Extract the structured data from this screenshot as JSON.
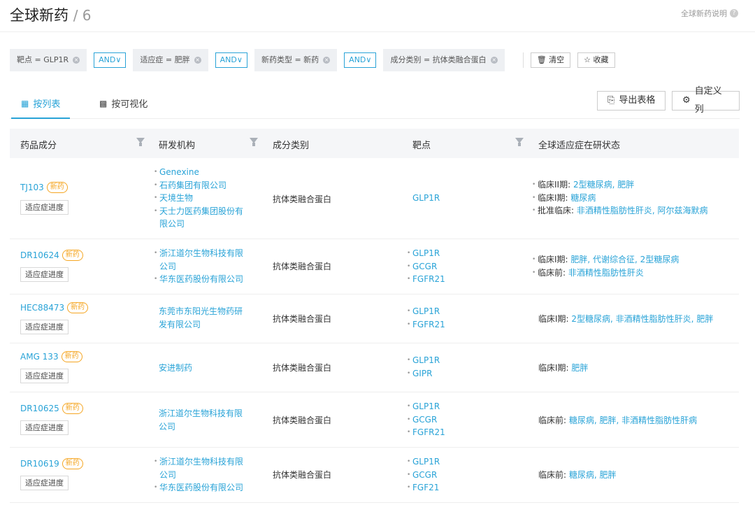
{
  "header": {
    "title": "全球新药",
    "count": "/ 6",
    "help": "全球新药说明"
  },
  "filters": [
    {
      "label": "靶点 = GLP1R"
    },
    {
      "label": "适应症 = 肥胖"
    },
    {
      "label": "新药类型 = 新药"
    },
    {
      "label": "成分类别 = 抗体类融合蛋白"
    }
  ],
  "and_label": "AND",
  "tools": {
    "clear": "清空",
    "favorite": "收藏"
  },
  "tabs": {
    "list": "按列表",
    "visual": "按可视化"
  },
  "buttons": {
    "export": "导出表格",
    "custom": "自定义列"
  },
  "columns": {
    "drug": "药品成分",
    "org": "研发机构",
    "category": "成分类别",
    "target": "靶点",
    "status": "全球适应症在研状态"
  },
  "badge": "新药",
  "progress_label": "适应症进度",
  "rows": [
    {
      "drug": "TJ103",
      "orgs": [
        "Genexine",
        "石药集团有限公司",
        "天境生物",
        "天士力医药集团股份有",
        "限公司"
      ],
      "category": "抗体类融合蛋白",
      "targets": [
        "GLP1R"
      ],
      "status": [
        {
          "stage": "临床II期:",
          "ind": "2型糖尿病, 肥胖"
        },
        {
          "stage": "临床I期:",
          "ind": "糖尿病"
        },
        {
          "stage": "批准临床:",
          "ind": "非酒精性脂肪性肝炎, 阿尔兹海默病"
        }
      ]
    },
    {
      "drug": "DR10624",
      "orgs": [
        "浙江道尔生物科技有限",
        "公司",
        "华东医药股份有限公司"
      ],
      "category": "抗体类融合蛋白",
      "targets": [
        "GLP1R",
        "GCGR",
        "FGFR21"
      ],
      "status": [
        {
          "stage": "临床I期:",
          "ind": "肥胖, 代谢综合征, 2型糖尿病"
        },
        {
          "stage": "临床前:",
          "ind": "非酒精性脂肪性肝炎"
        }
      ]
    },
    {
      "drug": "HEC88473",
      "orgs": [
        "东莞市东阳光生物药研",
        "发有限公司"
      ],
      "category": "抗体类融合蛋白",
      "targets": [
        "GLP1R",
        "FGFR21"
      ],
      "status": [
        {
          "stage": "临床I期:",
          "ind": "2型糖尿病, 非酒精性脂肪性肝炎, 肥胖"
        }
      ]
    },
    {
      "drug": "AMG 133",
      "orgs": [
        "安进制药"
      ],
      "category": "抗体类融合蛋白",
      "targets": [
        "GLP1R",
        "GIPR"
      ],
      "status": [
        {
          "stage": "临床I期:",
          "ind": "肥胖"
        }
      ]
    },
    {
      "drug": "DR10625",
      "orgs": [
        "浙江道尔生物科技有限",
        "公司"
      ],
      "category": "抗体类融合蛋白",
      "targets": [
        "GLP1R",
        "GCGR",
        "FGFR21"
      ],
      "status": [
        {
          "stage": "临床前:",
          "ind": "糖尿病, 肥胖, 非酒精性脂肪性肝病"
        }
      ]
    },
    {
      "drug": "DR10619",
      "orgs": [
        "浙江道尔生物科技有限",
        "公司",
        "华东医药股份有限公司"
      ],
      "category": "抗体类融合蛋白",
      "targets": [
        "GLP1R",
        "GCGR",
        "FGF21"
      ],
      "status": [
        {
          "stage": "临床前:",
          "ind": "糖尿病, 肥胖"
        }
      ]
    }
  ]
}
